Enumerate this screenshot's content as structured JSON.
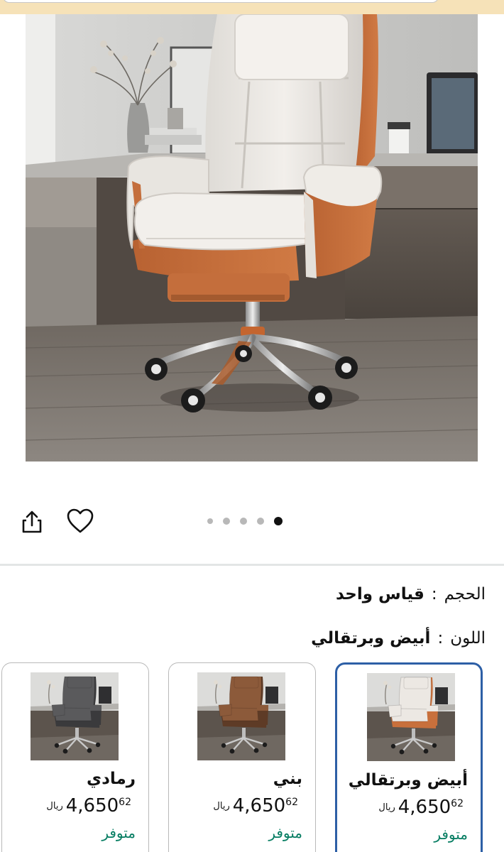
{
  "carousel": {
    "dot_count": 5,
    "active_index": 4
  },
  "attributes": {
    "size": {
      "label": "الحجم",
      "separator": ":",
      "value": "قياس واحد"
    },
    "color": {
      "label": "اللون",
      "separator": ":",
      "value": "أبيض وبرتقالي"
    }
  },
  "variants": [
    {
      "name": "أبيض وبرتقالي",
      "currency": "ريال",
      "price_main": "4,650",
      "price_fraction": "62",
      "availability": "متوفر",
      "selected": true,
      "seat_color": "#ece8e3",
      "side_color": "#c8703c"
    },
    {
      "name": "بني",
      "currency": "ريال",
      "price_main": "4,650",
      "price_fraction": "62",
      "availability": "متوفر",
      "selected": false,
      "seat_color": "#8c5a3a",
      "side_color": "#5e3b26"
    },
    {
      "name": "رمادي",
      "currency": "ريال",
      "price_main": "4,650",
      "price_fraction": "62",
      "availability": "متوفر",
      "selected": false,
      "seat_color": "#5a5a5c",
      "side_color": "#3a3a3c"
    }
  ],
  "colors": {
    "selected_border": "#2d5fa6",
    "in_stock": "#067d62",
    "chair_white": "#ece9e4",
    "chair_orange": "#c8703c"
  }
}
